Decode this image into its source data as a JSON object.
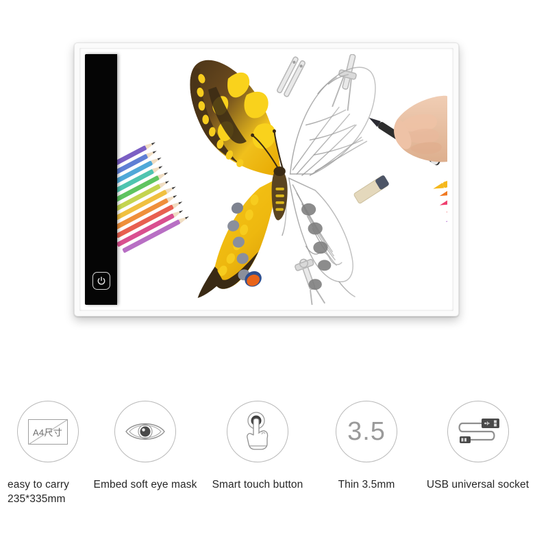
{
  "product": {
    "name": "A4 LED tracing light pad",
    "power_button_icon": "power-icon",
    "bezel_color": "#050505",
    "frame_color": "#fbfbfb",
    "artwork": {
      "subject": "swallowtail butterfly",
      "left_half": "colour photograph of butterfly",
      "right_half": "pencil line-drawing being traced",
      "hand_tool": "pencil",
      "accessories": [
        "colored pencils",
        "colored markers",
        "drafting compass",
        "divider",
        "eraser"
      ],
      "butterfly_colors": {
        "wing_yellow": "#f5c518",
        "wing_deep_yellow": "#e8a800",
        "wing_brown": "#4a3418",
        "wing_dark": "#2d2011",
        "spot_orange": "#e8641a",
        "spot_blue": "#2f4f8f",
        "sketch_line": "#9a9a9a"
      },
      "pencil_colors_left": [
        "#7b5fc4",
        "#5f7fd4",
        "#4fa8d8",
        "#4fc4b0",
        "#5fc45f",
        "#c4d44f",
        "#f0c040",
        "#ef8f3a",
        "#e85f4f",
        "#d94f8f",
        "#b86fc4",
        "#8f6f4f"
      ],
      "marker_colors_right": [
        "#f5b81c",
        "#f07820",
        "#ef3f6f",
        "#e83232",
        "#b066d0",
        "#8a5fd0",
        "#2f6fd8",
        "#3aa0e8",
        "#7ad040",
        "#3aa84a",
        "#dcdcdc",
        "#b0b0b0",
        "#a06a3a",
        "#7a4a22",
        "#3a2a1a",
        "#1a1a1a"
      ]
    }
  },
  "features": [
    {
      "id": "a4",
      "icon": "a4-size-icon",
      "icon_text": "A4尺寸",
      "caption": "easy to carry\n235*335mm"
    },
    {
      "id": "eye",
      "icon": "eye-icon",
      "icon_text": "",
      "caption": "Embed soft eye mask"
    },
    {
      "id": "touch",
      "icon": "touch-hand-icon",
      "icon_text": "",
      "caption": "Smart touch button"
    },
    {
      "id": "thin",
      "icon": "thickness-number-icon",
      "icon_text": "3.5",
      "caption": "Thin 3.5mm"
    },
    {
      "id": "usb",
      "icon": "usb-cable-icon",
      "icon_text": "",
      "caption": "USB universal socket"
    }
  ],
  "colors": {
    "background": "#ffffff",
    "icon_outline": "#b9b9b9",
    "icon_stroke": "#8f8f8f",
    "caption_text": "#262626",
    "usb_connector": "#4a4a4a"
  }
}
